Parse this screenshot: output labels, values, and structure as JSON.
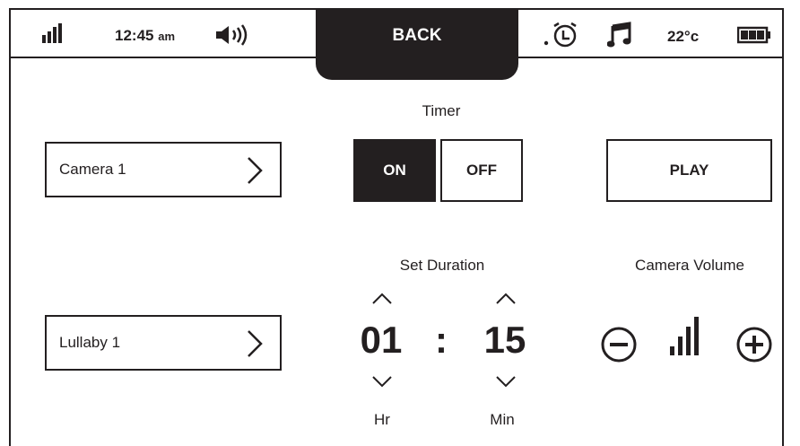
{
  "status": {
    "time": "12:45",
    "ampm": "am",
    "temperature": "22°c",
    "back_label": "BACK"
  },
  "camera_selector": {
    "label": "Camera 1"
  },
  "lullaby_selector": {
    "label": "Lullaby 1"
  },
  "timer": {
    "title": "Timer",
    "on_label": "ON",
    "off_label": "OFF",
    "state": "ON"
  },
  "play_button": {
    "label": "PLAY"
  },
  "duration": {
    "title": "Set Duration",
    "hours": "01",
    "separator": ":",
    "minutes": "15",
    "hours_label": "Hr",
    "minutes_label": "Min"
  },
  "volume": {
    "title": "Camera Volume"
  },
  "icons": [
    "signal-icon",
    "speaker-icon",
    "alarm-clock-icon",
    "music-note-icon",
    "battery-icon",
    "minus-circle-icon",
    "volume-level-icon",
    "plus-circle-icon",
    "chevron-right-icon",
    "chevron-up-icon",
    "chevron-down-icon"
  ],
  "colors": {
    "ink": "#231f20",
    "background": "#ffffff"
  }
}
